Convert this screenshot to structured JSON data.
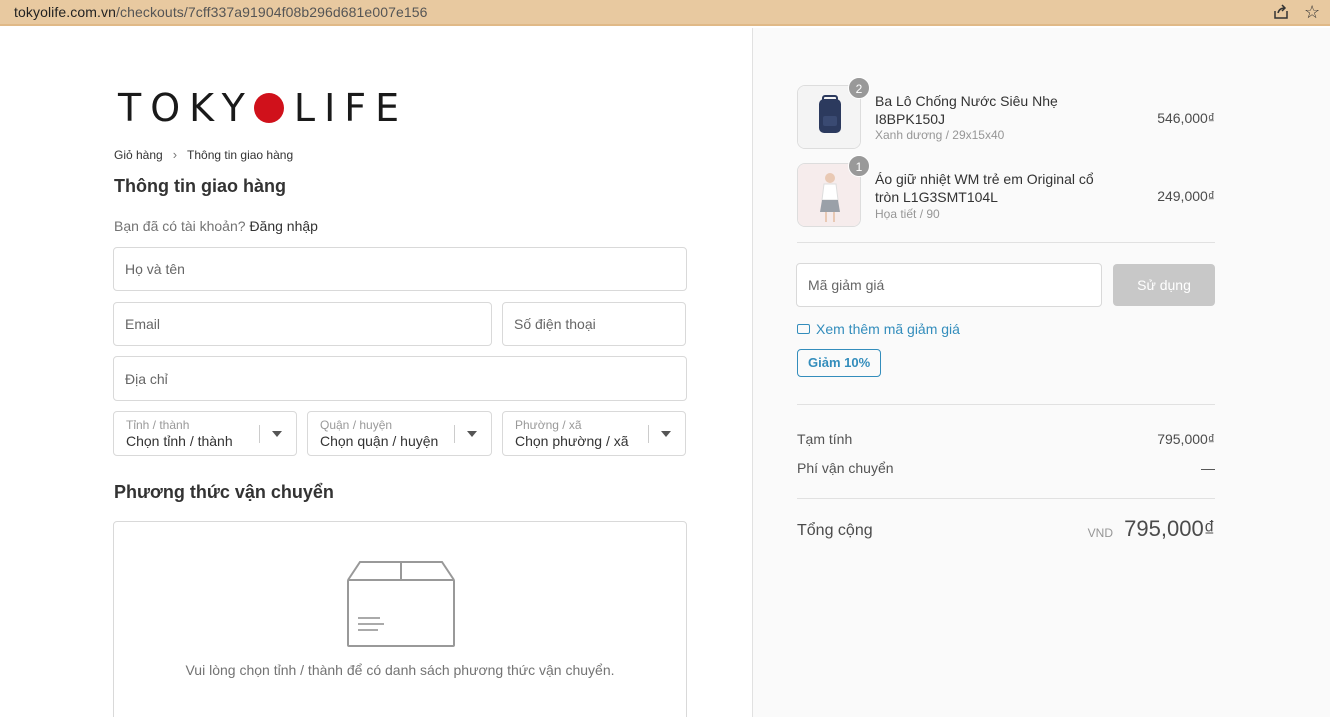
{
  "browser": {
    "url_host": "tokyolife.com.vn",
    "url_path": "/checkouts/7cff337a91904f08b296d681e007e156"
  },
  "brand": {
    "logo_left": "TOKY",
    "logo_right": "LIFE",
    "logo_dot_color": "#d0111b"
  },
  "breadcrumb": {
    "items": [
      "Giỏ hàng",
      "Thông tin giao hàng"
    ]
  },
  "shipping_info": {
    "title": "Thông tin giao hàng",
    "login_prompt": "Bạn đã có tài khoản?",
    "login_link": "Đăng nhập",
    "fullname_placeholder": "Họ và tên",
    "email_placeholder": "Email",
    "phone_placeholder": "Số điện thoại",
    "address_placeholder": "Địa chỉ",
    "province": {
      "label": "Tỉnh / thành",
      "value": "Chọn tỉnh / thành"
    },
    "district": {
      "label": "Quận / huyện",
      "value": "Chọn quận / huyện"
    },
    "ward": {
      "label": "Phường / xã",
      "value": "Chọn phường / xã"
    }
  },
  "shipping_method": {
    "title": "Phương thức vận chuyển",
    "empty_message": "Vui lòng chọn tỉnh / thành để có danh sách phương thức vận chuyển."
  },
  "order": {
    "items": [
      {
        "quantity": "2",
        "name": "Ba Lô Chống Nước Siêu Nhẹ I8BPK150J",
        "variant": "Xanh dương / 29x15x40",
        "price": "546,000₫"
      },
      {
        "quantity": "1",
        "name": "Áo giữ nhiệt WM trẻ em Original cổ tròn L1G3SMT104L",
        "variant": "Họa tiết / 90",
        "price": "249,000₫"
      }
    ],
    "coupon_placeholder": "Mã giảm giá",
    "apply_label": "Sử dụng",
    "more_coupons_label": "Xem thêm mã giảm giá",
    "discount_tag": "Giảm 10%",
    "subtotal_label": "Tạm tính",
    "subtotal_value": "795,000₫",
    "shipping_label": "Phí vận chuyển",
    "shipping_value": "—",
    "total_label": "Tổng cộng",
    "currency": "VND",
    "total_value": "795,000₫"
  },
  "colors": {
    "accent": "#338dbc",
    "button_disabled": "#c8c8c8",
    "addressbar": "#e8c9a0"
  }
}
